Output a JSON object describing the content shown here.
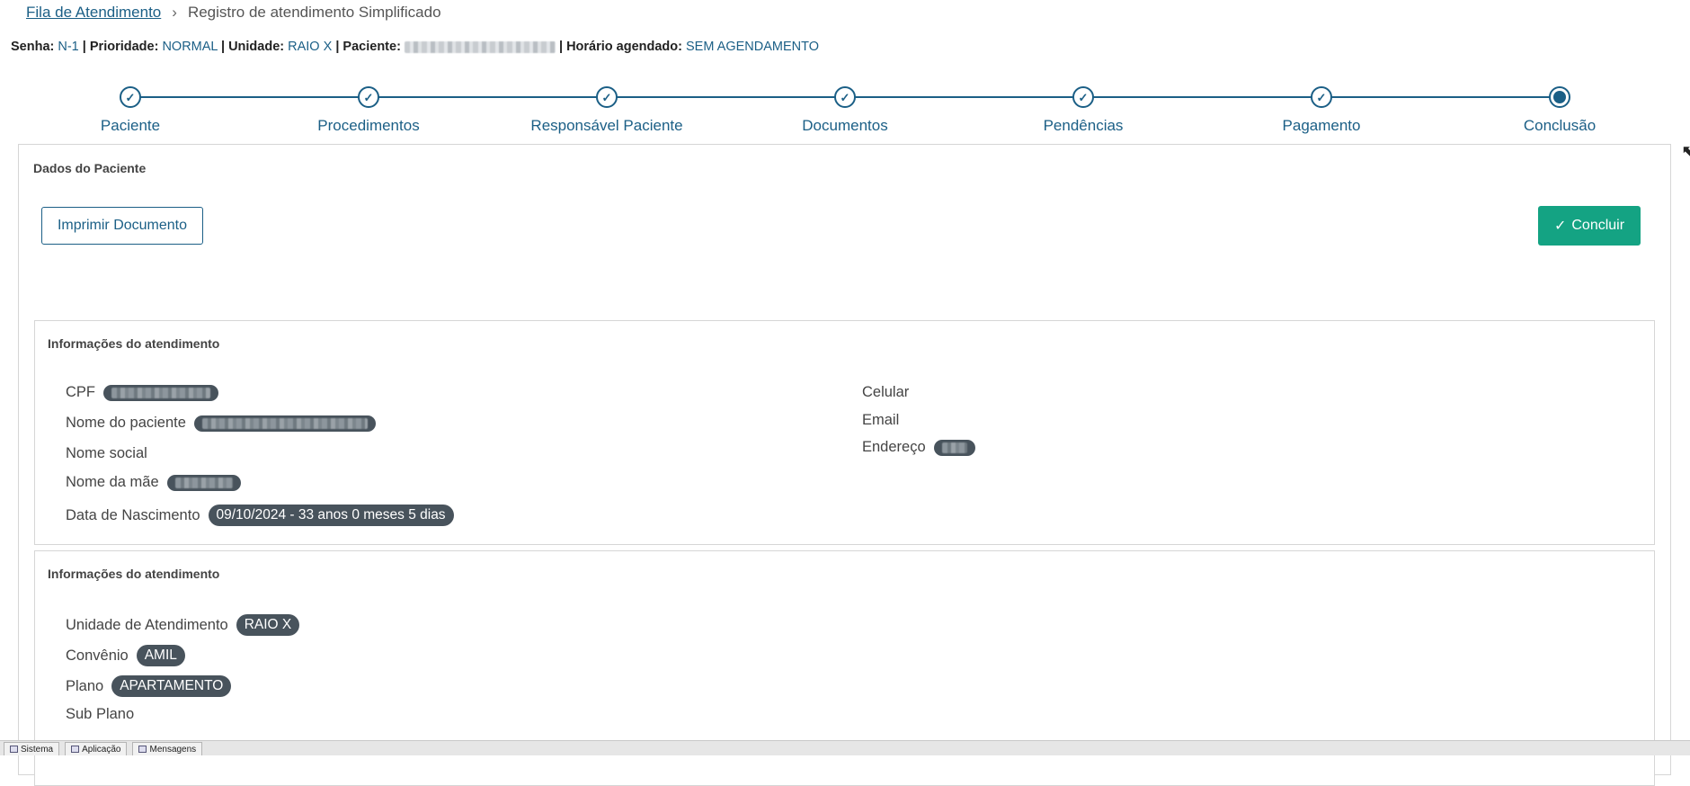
{
  "breadcrumb": {
    "parent": "Fila de Atendimento",
    "current": "Registro de atendimento Simplificado"
  },
  "infoline": {
    "senha_label": "Senha:",
    "senha": "N-1",
    "prioridade_label": "Prioridade:",
    "prioridade": "NORMAL",
    "unidade_label": "Unidade:",
    "unidade": "RAIO X",
    "paciente_label": "Paciente:",
    "horario_label": "Horário agendado:",
    "horario": "SEM AGENDAMENTO",
    "separator": "|"
  },
  "stepper": {
    "steps": [
      {
        "label": "Paciente"
      },
      {
        "label": "Procedimentos"
      },
      {
        "label": "Responsável Paciente"
      },
      {
        "label": "Documentos"
      },
      {
        "label": "Pendências"
      },
      {
        "label": "Pagamento"
      },
      {
        "label": "Conclusão"
      }
    ],
    "check_glyph": "✓"
  },
  "panel": {
    "title": "Dados do Paciente",
    "print_button": "Imprimir Documento",
    "conclude_button": "Concluir",
    "conclude_icon": "✓"
  },
  "section1": {
    "title": "Informações do atendimento",
    "cpf_label": "CPF",
    "nome_label": "Nome do paciente",
    "nome_social_label": "Nome social",
    "mae_label": "Nome da mãe",
    "nascimento_label": "Data de Nascimento",
    "nascimento_value": "09/10/2024 - 33 anos 0 meses 5 dias",
    "celular_label": "Celular",
    "email_label": "Email",
    "endereco_label": "Endereço"
  },
  "section2": {
    "title": "Informações do atendimento",
    "unidade_label": "Unidade de Atendimento",
    "unidade_value": "RAIO X",
    "convenio_label": "Convênio",
    "convenio_value": "AMIL",
    "plano_label": "Plano",
    "plano_value": "APARTAMENTO",
    "subplano_label": "Sub Plano"
  },
  "taskbar": {
    "items": [
      "Sistema",
      "Aplicação",
      "Mensagens"
    ]
  },
  "colors": {
    "accent": "#1b5f86",
    "success": "#14a383",
    "pill": "#48535c"
  }
}
